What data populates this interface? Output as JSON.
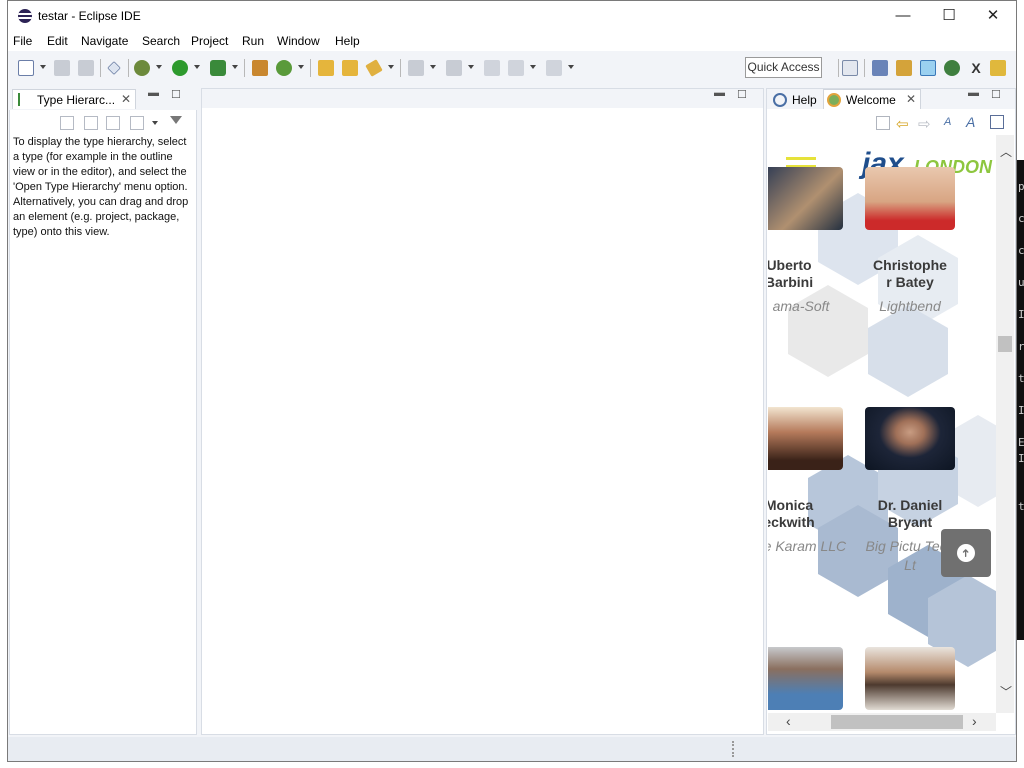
{
  "window": {
    "title": "testar - Eclipse IDE",
    "minimize_glyph": "—",
    "maximize_glyph": "☐",
    "close_glyph": "✕"
  },
  "menu": [
    "File",
    "Edit",
    "Navigate",
    "Search",
    "Project",
    "Run",
    "Window",
    "Help"
  ],
  "toolbar": {
    "quick_access": "Quick Access"
  },
  "left_view": {
    "tab_label": "Type Hierarc...",
    "message": "To display the type hierarchy, select a type (for example in the outline view or in the editor), and select the 'Open Type Hierarchy' menu option. Alternatively, you can drag and drop an element (e.g. project, package, type) onto this view."
  },
  "right_view": {
    "tabs": [
      {
        "label": "Help",
        "active": false
      },
      {
        "label": "Welcome",
        "active": true
      }
    ]
  },
  "web": {
    "logo_jax": "jax",
    "logo_london": "LONDON",
    "speakers": [
      {
        "name": "Uberto Barbini",
        "name_visible": "Uberto\nBarbini",
        "company": "ama-Soft"
      },
      {
        "name": "Christopher Batey",
        "name_visible": "Christophe\nr Batey",
        "company": "Lightbend"
      },
      {
        "name": "Monica Beckwith",
        "name_visible": "Monica\neckwith",
        "company": "de Karam LLC"
      },
      {
        "name": "Dr. Daniel Bryant",
        "name_visible": "Dr. Daniel\nBryant",
        "company": "Big Pictu Tech Lt"
      }
    ],
    "back_to_top_glyph": "➜"
  },
  "desktop_strip_chars": [
    "p",
    "c",
    "c",
    "u",
    "I",
    "r",
    "t",
    "I",
    "E",
    "I",
    "t"
  ],
  "colors": {
    "logo_blue": "#1f4e8c",
    "logo_green": "#8dc63f",
    "hamburger": "#e6e23a",
    "hex_blue": "#8fa6c4"
  }
}
